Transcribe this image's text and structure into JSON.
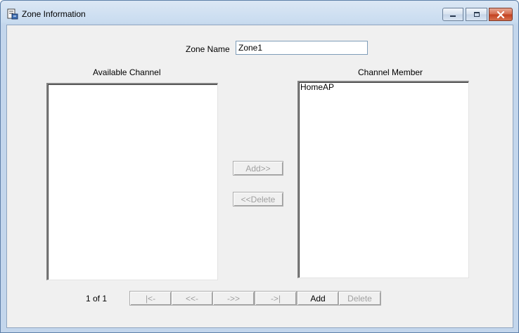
{
  "window": {
    "title": "Zone Information"
  },
  "form": {
    "zone_name_label": "Zone Name",
    "zone_name_value": "Zone1",
    "available_label": "Available Channel",
    "member_label": "Channel Member",
    "available_items": [],
    "member_items": [
      "HomeAP"
    ],
    "add_label": "Add>>",
    "delete_label": "<<Delete"
  },
  "pager": {
    "status": "1 of 1",
    "first_label": "|<-",
    "prev_label": "<<-",
    "next_label": "->>",
    "last_label": "->|",
    "add_label": "Add",
    "delete_label": "Delete"
  }
}
